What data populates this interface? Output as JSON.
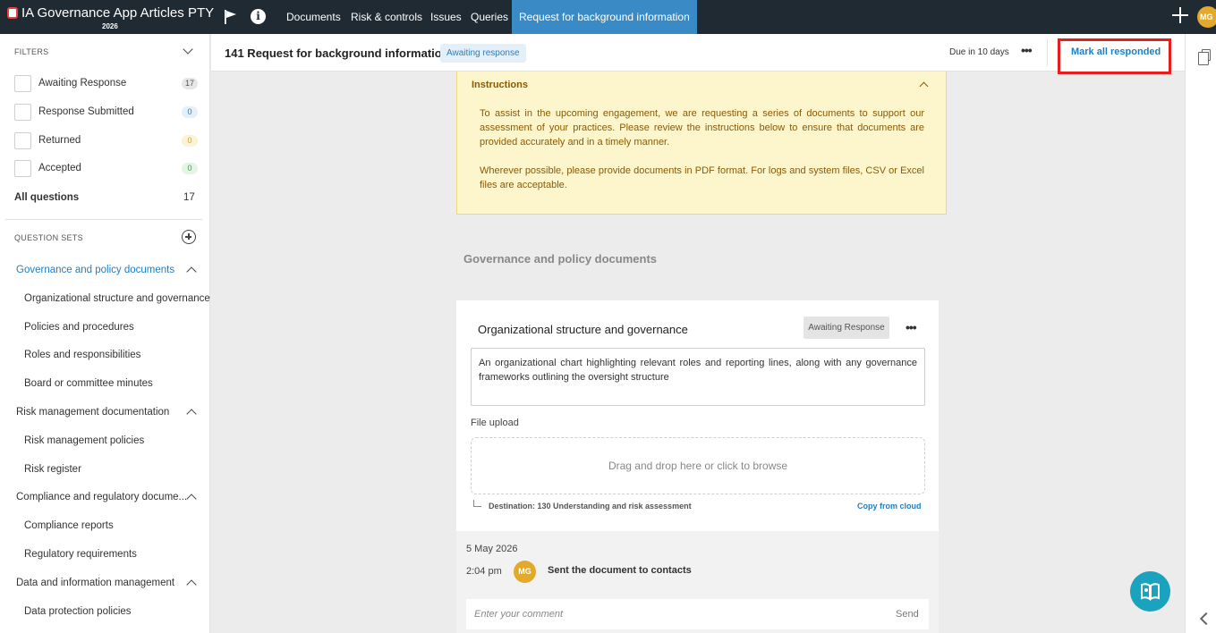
{
  "topnav": {
    "app_title": "IA Governance App Articles PTY",
    "app_year": "2026",
    "tabs": [
      {
        "label": "Documents"
      },
      {
        "label": "Risk & controls"
      },
      {
        "label": "Issues"
      },
      {
        "label": "Queries"
      },
      {
        "label": "Request for background information",
        "active": true
      }
    ],
    "avatar_initials": "MG",
    "icons": [
      "flag-icon",
      "info-icon",
      "plus-icon"
    ]
  },
  "sidebar": {
    "filters_label": "FILTERS",
    "filters": [
      {
        "label": "Awaiting Response",
        "count": "17",
        "color": "#e6e6e6"
      },
      {
        "label": "Response Submitted",
        "count": "0",
        "color": "#e3f0fa"
      },
      {
        "label": "Returned",
        "count": "0",
        "color": "#fbf3d5"
      },
      {
        "label": "Accepted",
        "count": "0",
        "color": "#e4f5e6"
      }
    ],
    "all_questions_label": "All questions",
    "all_questions_count": "17",
    "question_sets_label": "QUESTION SETS",
    "groups": [
      {
        "label": "Governance and policy documents",
        "active": true,
        "items": [
          "Organizational structure and governance",
          "Policies and procedures",
          "Roles and responsibilities",
          "Board or committee minutes"
        ]
      },
      {
        "label": "Risk management documentation",
        "items": [
          "Risk management policies",
          "Risk register"
        ]
      },
      {
        "label": "Compliance and regulatory docume...",
        "items": [
          "Compliance reports",
          "Regulatory requirements"
        ]
      },
      {
        "label": "Data and information management",
        "items": [
          "Data protection policies"
        ]
      }
    ]
  },
  "header": {
    "title": "141 Request for background information",
    "status_badge": "Awaiting response",
    "due": "Due in 10 days",
    "mark_all_label": "Mark all responded"
  },
  "instructions": {
    "title": "Instructions",
    "paragraph1": "To assist in the upcoming engagement, we are requesting a series of documents to support our assessment of your practices. Please review the instructions below to ensure that documents are provided accurately and in a timely manner.",
    "paragraph2": "Wherever possible, please provide documents in PDF format. For logs and system files, CSV or Excel files are acceptable."
  },
  "section_title": "Governance and policy documents",
  "card": {
    "title": "Organizational structure and governance",
    "status": "Awaiting Response",
    "description": "An organizational chart highlighting relevant roles and reporting lines, along with any governance frameworks outlining the oversight structure",
    "file_upload_label": "File upload",
    "dropzone_text": "Drag and drop here or click to browse",
    "destination": "Destination: 130 Understanding and risk assessment",
    "copy_from_cloud": "Copy from cloud",
    "activity": {
      "date": "5 May 2026",
      "time": "2:04 pm",
      "avatar_initials": "MG",
      "text": "Sent the document to contacts"
    },
    "comment_placeholder": "Enter your comment",
    "send_label": "Send"
  },
  "colors": {
    "nav_bg": "#1f2a33",
    "active_tab": "#3a8ac5",
    "accent_blue": "#1d7fc4",
    "instructions_bg": "#fdf6cc",
    "avatar": "#e3a92b",
    "highlight_box": "#e81e1e",
    "help_fab": "#1aa2bf"
  }
}
